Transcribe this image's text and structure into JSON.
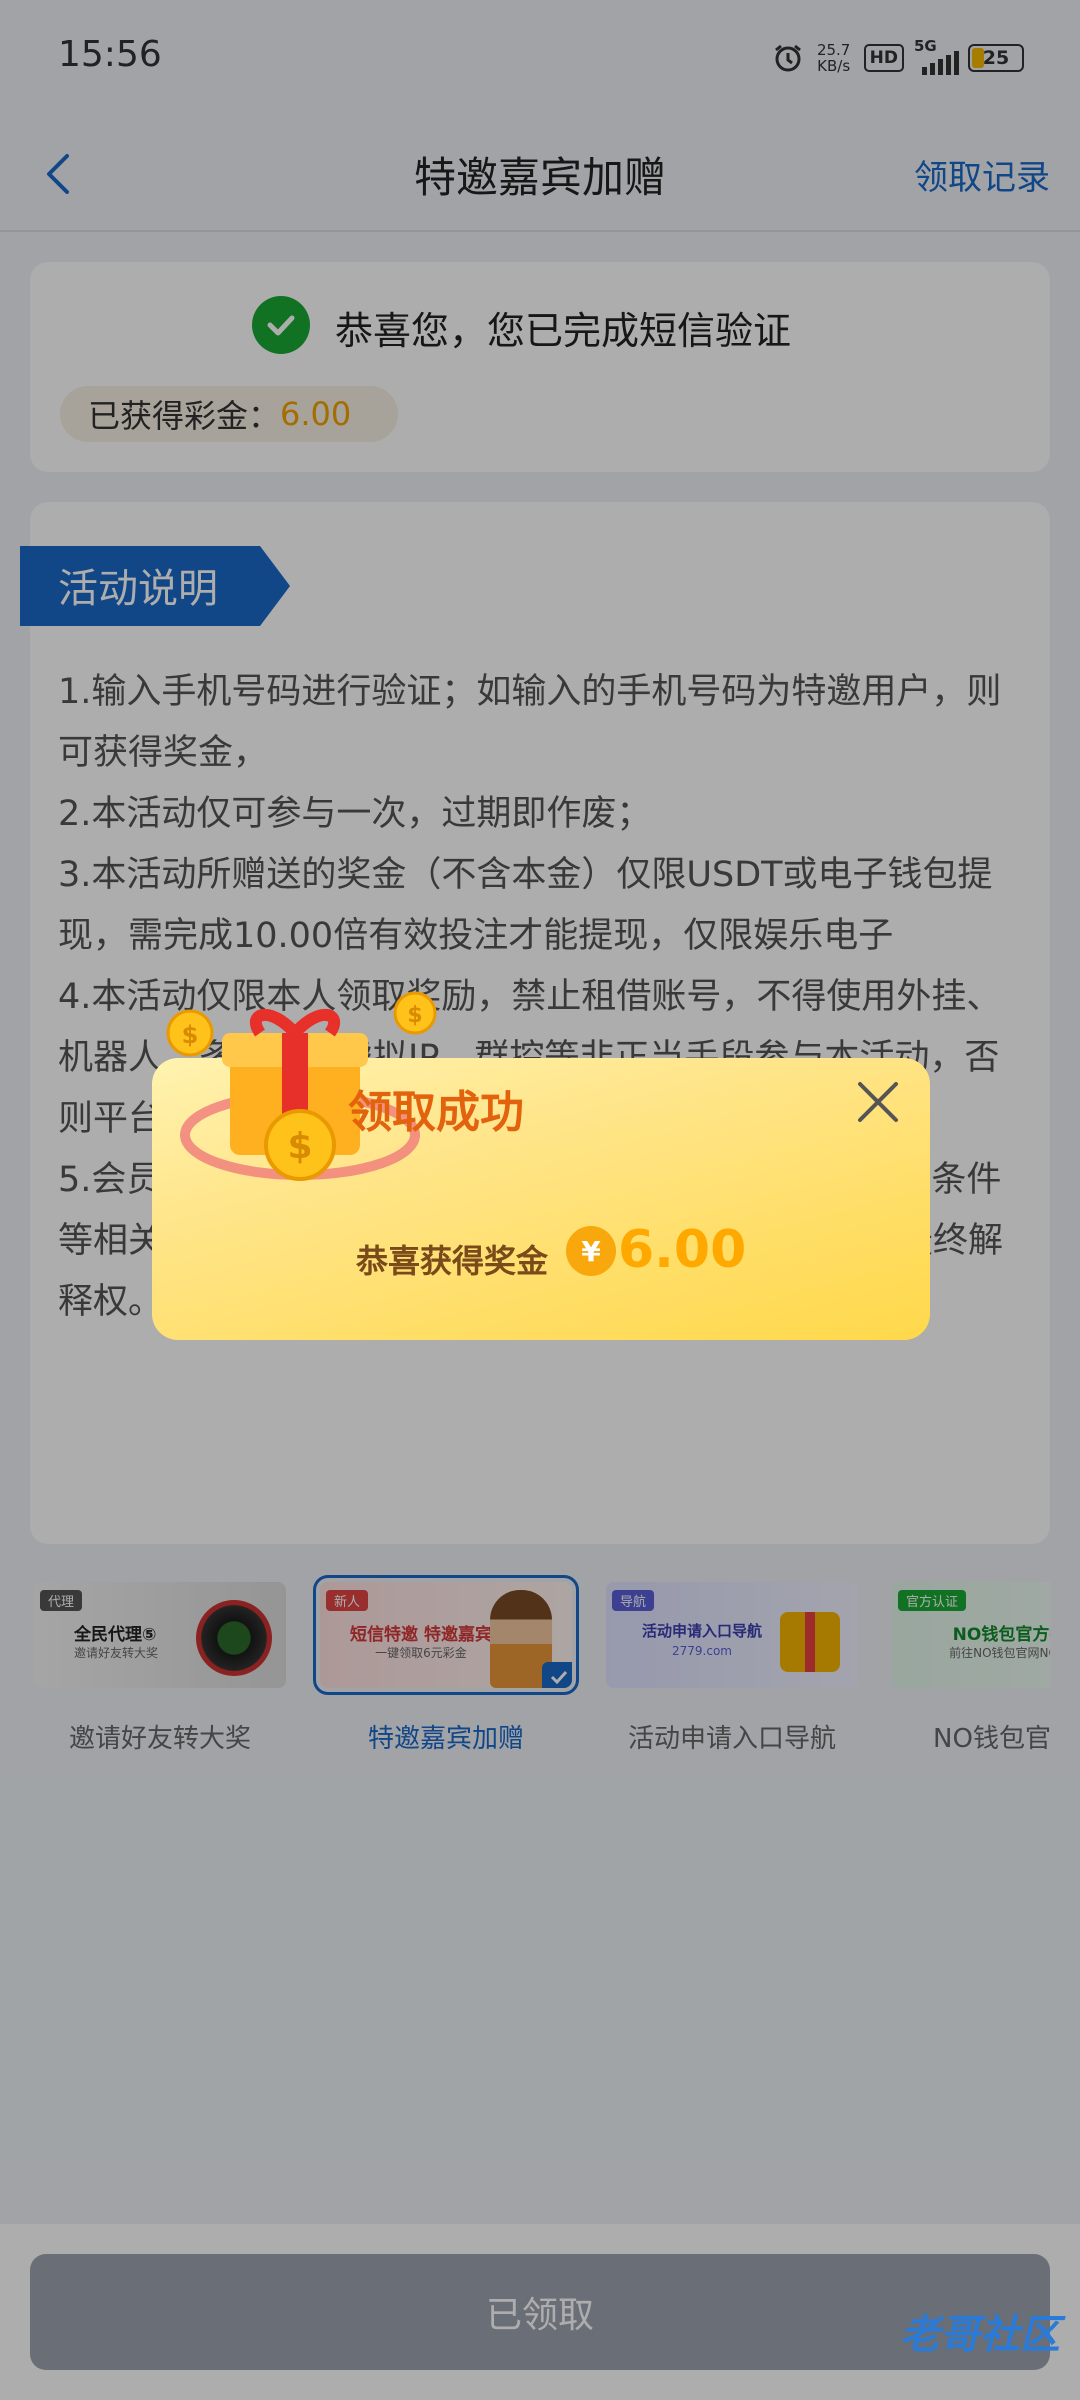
{
  "status_bar": {
    "time": "15:56",
    "net_speed": "25.7",
    "net_unit": "KB/s",
    "hd": "HD",
    "network": "5G",
    "battery": "25"
  },
  "nav": {
    "title": "特邀嘉宾加赠",
    "records_link": "领取记录"
  },
  "verification": {
    "message": "恭喜您，您已完成短信验证",
    "earned_label": "已获得彩金：",
    "earned_amount": "6.00"
  },
  "activity": {
    "heading": "活动说明",
    "rules": [
      "1.输入手机号码进行验证；如输入的手机号码为特邀用户，则可获得奖金，",
      "2.本活动仅可参与一次，过期即作废；",
      "3.本活动所赠送的奖金（不含本金）仅限USDT或电子钱包提现，需完成10.00倍有效投注才能提现，仅限娱乐电子",
      "4.本活动仅限本人领取奖励，禁止租借账号，不得使用外挂、机器人、多账户、虚拟IP、群控等非正当手段参与本活动，否则平台有权终止活动，并没收账户奖金和不当得利；",
      "5.会员参与该活动时，本平台将默认会员同意且遵守对应条件等相关规定，为避免文字理解歧义，本平台保有本活动最终解释权。"
    ]
  },
  "tabs": [
    {
      "caption": "邀请好友转大奖",
      "tag": "代理",
      "thumb_title": "全民代理⑤",
      "thumb_sub": "邀请好友转大奖",
      "active": false
    },
    {
      "caption": "特邀嘉宾加赠",
      "tag": "新人",
      "thumb_title": "短信特邀 特邀嘉宾",
      "thumb_sub": "一键领取6元彩金",
      "active": true
    },
    {
      "caption": "活动申请入口导航",
      "tag": "导航",
      "thumb_title": "活动申请入口导航",
      "thumb_sub": "2779.com",
      "active": false
    },
    {
      "caption": "NO钱包官方担",
      "tag": "官方认证",
      "thumb_title": "NO钱包官方担保",
      "thumb_sub": "前往NO钱包官网NO.com",
      "active": false
    }
  ],
  "bottom": {
    "claimed_button": "已领取",
    "watermark": "老哥社区"
  },
  "popup": {
    "title": "领取成功",
    "message": "恭喜获得奖金",
    "currency_symbol": "¥",
    "amount": "6.00"
  },
  "colors": {
    "accent_blue": "#1a67c7",
    "success_green": "#1aa836",
    "gold": "#f1a100",
    "popup_title": "#e2620e"
  }
}
